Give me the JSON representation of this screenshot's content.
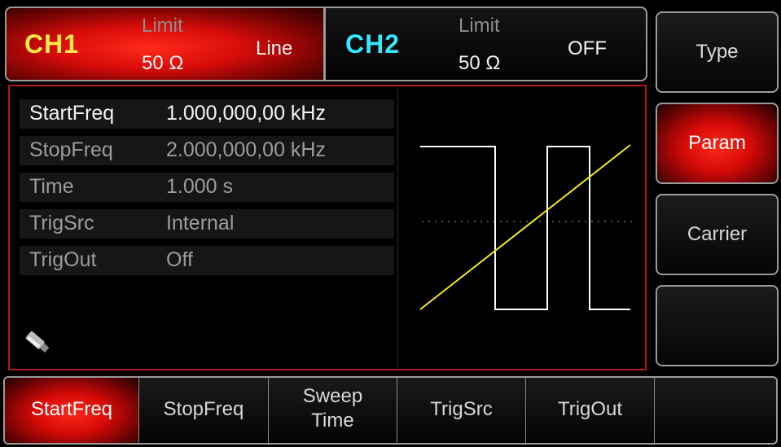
{
  "channels": {
    "ch1": {
      "name": "CH1",
      "limit": "Limit",
      "impedance": "50 Ω",
      "mode": "Line",
      "name_color": "#ffe94a"
    },
    "ch2": {
      "name": "CH2",
      "limit": "Limit",
      "impedance": "50 Ω",
      "mode": "OFF",
      "name_color": "#38e6ff"
    }
  },
  "params": [
    {
      "label": "StartFreq",
      "value": "1.000,000,00 kHz",
      "active": true
    },
    {
      "label": "StopFreq",
      "value": "2.000,000,00 kHz",
      "active": false
    },
    {
      "label": "Time",
      "value": "1.000 s",
      "active": false
    },
    {
      "label": "TrigSrc",
      "value": "Internal",
      "active": false
    },
    {
      "label": "TrigOut",
      "value": "Off",
      "active": false
    }
  ],
  "icons": {
    "usb": "usb-drive-icon"
  },
  "right_menu": [
    {
      "label": "Type",
      "active": false
    },
    {
      "label": "Param",
      "active": true
    },
    {
      "label": "Carrier",
      "active": false
    },
    {
      "label": "",
      "active": false
    }
  ],
  "bottom_menu": [
    {
      "label": "StartFreq",
      "active": true
    },
    {
      "label": "StopFreq",
      "active": false
    },
    {
      "label": "Sweep Time",
      "line1": "Sweep",
      "line2": "Time",
      "active": false
    },
    {
      "label": "TrigSrc",
      "active": false
    },
    {
      "label": "TrigOut",
      "active": false
    },
    {
      "label": "",
      "active": false
    }
  ],
  "colors": {
    "accent_red": "#d80c0a",
    "sweep_line": "#f0e81a",
    "trigger_wave": "#ffffff"
  }
}
